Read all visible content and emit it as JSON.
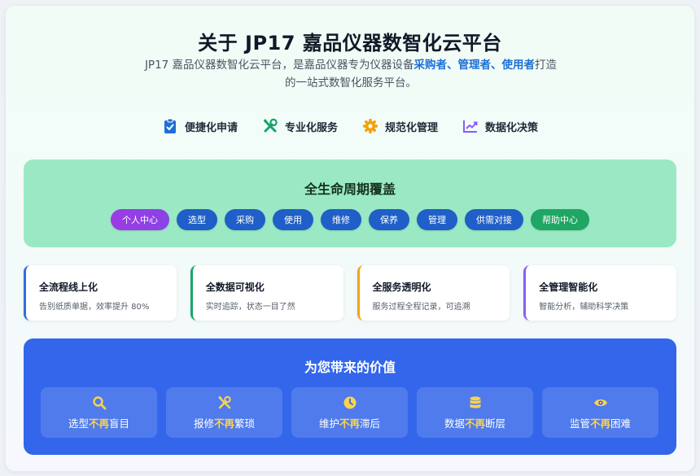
{
  "header": {
    "title": "关于 JP17 嘉品仪器数智化云平台",
    "intro_prefix": "JP17 嘉品仪器数智化云平台，是嘉品仪器专为仪器设备",
    "intro_highlight": "采购者、管理者、使用者",
    "intro_line1_suffix": "打造",
    "intro_line2": "的一站式数智化服务平台。"
  },
  "features": [
    {
      "label": "便捷化申请",
      "icon": "clipboard-check-icon",
      "color": "#1d6fd6"
    },
    {
      "label": "专业化服务",
      "icon": "tools-icon",
      "color": "#16a36a"
    },
    {
      "label": "规范化管理",
      "icon": "gear-icon",
      "color": "#f5a10c"
    },
    {
      "label": "数据化决策",
      "icon": "trend-chart-icon",
      "color": "#8b5cf6"
    }
  ],
  "lifecycle": {
    "title": "全生命周期覆盖",
    "stages": [
      "个人中心",
      "选型",
      "采购",
      "使用",
      "维修",
      "保养",
      "管理",
      "供需对接",
      "帮助中心"
    ]
  },
  "cards": [
    {
      "title": "全流程线上化",
      "desc": "告别纸质单据，效率提升 80%",
      "color": "#2f6fdc"
    },
    {
      "title": "全数据可视化",
      "desc": "实时追踪，状态一目了然",
      "color": "#19a56a"
    },
    {
      "title": "全服务透明化",
      "desc": "服务过程全程记录，可追溯",
      "color": "#f2a31a"
    },
    {
      "title": "全管理智能化",
      "desc": "智能分析，辅助科学决策",
      "color": "#8b5cf6"
    }
  ],
  "value": {
    "title": "为您带来的价值",
    "items": [
      {
        "pre": "选型",
        "no": "不再",
        "post": "盲目",
        "icon": "search-icon"
      },
      {
        "pre": "报修",
        "no": "不再",
        "post": "繁琐",
        "icon": "tools-icon"
      },
      {
        "pre": "维护",
        "no": "不再",
        "post": "滞后",
        "icon": "clock-icon"
      },
      {
        "pre": "数据",
        "no": "不再",
        "post": "断层",
        "icon": "database-icon"
      },
      {
        "pre": "监管",
        "no": "不再",
        "post": "困难",
        "icon": "eye-icon"
      }
    ],
    "accent": "#fcd34d"
  }
}
